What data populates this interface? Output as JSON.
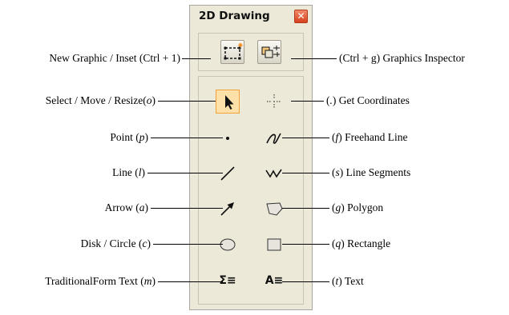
{
  "window": {
    "title": "2D Drawing",
    "close_symbol": "✕"
  },
  "tools": {
    "new_graphic": {
      "icon": "new-graphic-icon"
    },
    "graphics_inspector": {
      "icon": "graphics-inspector-icon"
    },
    "select": {
      "icon": "arrow-cursor-icon",
      "selected": true
    },
    "get_coordinates": {
      "icon": "crosshair-icon"
    },
    "point": {
      "icon": "point-icon"
    },
    "freehand_line": {
      "icon": "freehand-line-icon"
    },
    "line": {
      "icon": "line-icon"
    },
    "line_segments": {
      "icon": "line-segments-icon"
    },
    "arrow": {
      "icon": "arrow-icon"
    },
    "polygon": {
      "icon": "polygon-icon"
    },
    "disk": {
      "icon": "ellipse-icon"
    },
    "rectangle": {
      "icon": "rectangle-icon"
    },
    "traditional_text": {
      "glyph": "Σ≡"
    },
    "text": {
      "glyph": "A≡"
    }
  },
  "labels": {
    "new_graphic": {
      "text": "New Graphic / Inset (Ctrl + 1)"
    },
    "graphics_inspector": {
      "text": "(Ctrl + g)  Graphics Inspector"
    },
    "select": {
      "pre": "Select / Move / Resize(",
      "key": "o",
      "post": ")"
    },
    "get_coordinates": {
      "pre": "(",
      "key": ".",
      "post": ") Get Coordinates"
    },
    "point": {
      "pre": "Point  (",
      "key": "p",
      "post": ")"
    },
    "freehand_line": {
      "pre": "(",
      "key": "f",
      "post": ")  Freehand Line"
    },
    "line": {
      "pre": "Line  (",
      "key": "l",
      "post": ")"
    },
    "line_segments": {
      "pre": "(",
      "key": "s",
      "post": ")  Line Segments"
    },
    "arrow": {
      "pre": "Arrow  (",
      "key": "a",
      "post": ")"
    },
    "polygon": {
      "pre": "(",
      "key": "g",
      "post": ")  Polygon"
    },
    "disk": {
      "pre": "Disk / Circle  (",
      "key": "c",
      "post": ")"
    },
    "rectangle": {
      "pre": "(",
      "key": "q",
      "post": ")   Rectangle"
    },
    "traditional_text": {
      "pre": "TraditionalForm Text  (",
      "key": "m",
      "post": ")"
    },
    "text": {
      "pre": "(",
      "key": "t",
      "post": ")  Text"
    }
  },
  "colors": {
    "panel_bg": "#ece9d8",
    "selected_bg": "#fde1a8",
    "selected_border": "#f2a23a",
    "close_red": "#d6411f",
    "star_orange": "#f28a1a"
  }
}
